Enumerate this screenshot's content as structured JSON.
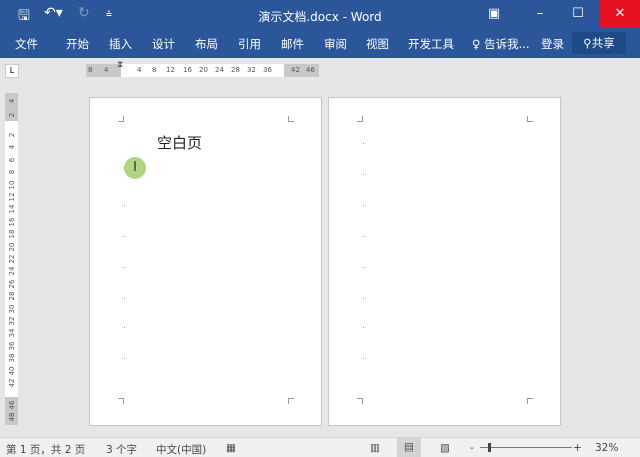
{
  "title": "演示文档.docx - Word",
  "tabs": [
    "文件",
    "开始",
    "插入",
    "设计",
    "布局",
    "引用",
    "邮件",
    "审阅",
    "视图",
    "开发工具"
  ],
  "tell_me": "告诉我...",
  "login": "登录",
  "share": "共享",
  "ruler_h": [
    "8",
    "4",
    "4",
    "8",
    "12",
    "16",
    "20",
    "24",
    "28",
    "32",
    "36",
    "42",
    "46"
  ],
  "ruler_v": [
    "2",
    "4",
    "2",
    "4",
    "6",
    "8",
    "10",
    "12",
    "14",
    "16",
    "18",
    "20",
    "22",
    "24",
    "26",
    "28",
    "30",
    "32",
    "34",
    "36",
    "38",
    "40",
    "42",
    "46",
    "48"
  ],
  "document": {
    "text": "空白页"
  },
  "status": {
    "page": "第 1 页，共 2 页",
    "words": "3 个字",
    "language": "中文(中国)",
    "zoom": "32%"
  },
  "colors": {
    "accent": "#2b579a",
    "close": "#e81123"
  }
}
